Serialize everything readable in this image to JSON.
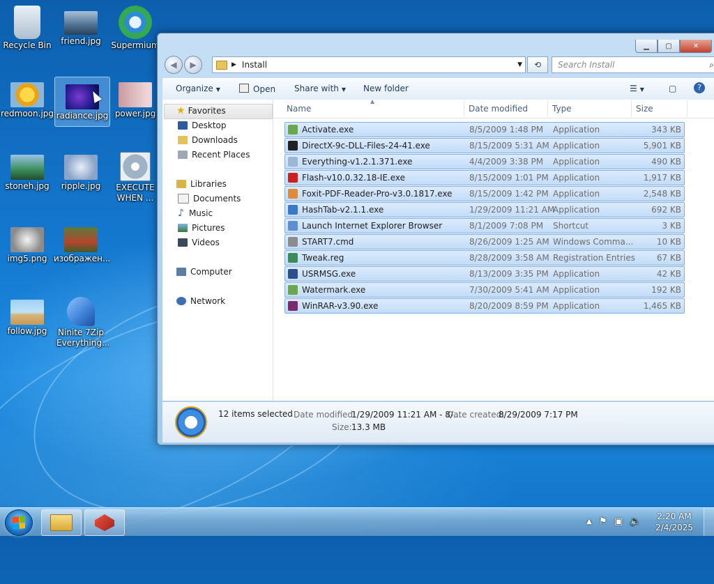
{
  "desktop": {
    "icons": [
      {
        "label": "Recycle Bin",
        "color": "#c9d7e3"
      },
      {
        "label": "friend.jpg",
        "color": "#6a8db1"
      },
      {
        "label": "Supermium",
        "color": "#2f9b4a"
      },
      {
        "label": "redmoon.jpg",
        "color": "#e8a317"
      },
      {
        "label": "radiance.jpg",
        "color": "#231a8c"
      },
      {
        "label": "power.jpg",
        "color": "#e6c0c6"
      },
      {
        "label": "stoneh.jpg",
        "color": "#3c8d5a"
      },
      {
        "label": "ripple.jpg",
        "color": "#8aa3c8"
      },
      {
        "label": "EXECUTE WHEN ...",
        "color": "#9fb3c5"
      },
      {
        "label": "img5.png",
        "color": "#8b8b8b"
      },
      {
        "label": "изображен...",
        "color": "#b4462e"
      },
      {
        "label": "follow.jpg",
        "color": "#d7b47a"
      },
      {
        "label": "Ninite 7Zip Everything...",
        "color": "#3b7fd6"
      }
    ]
  },
  "window": {
    "address_path": "Install",
    "search_placeholder": "Search Install",
    "commands": {
      "organize": "Organize",
      "open": "Open",
      "share_with": "Share with",
      "new_folder": "New folder"
    },
    "nav": {
      "favorites": "Favorites",
      "desktop": "Desktop",
      "downloads": "Downloads",
      "recent_places": "Recent Places",
      "libraries": "Libraries",
      "documents": "Documents",
      "music": "Music",
      "pictures": "Pictures",
      "videos": "Videos",
      "computer": "Computer",
      "network": "Network"
    },
    "columns": {
      "name": "Name",
      "date_modified": "Date modified",
      "type": "Type",
      "size": "Size"
    },
    "files": [
      {
        "name": "Activate.exe",
        "date": "8/5/2009 1:48 PM",
        "type": "Application",
        "size": "343 KB",
        "icon_color": "#6aa84f"
      },
      {
        "name": "DirectX-9c-DLL-Files-24-41.exe",
        "date": "8/15/2009 5:31 AM",
        "type": "Application",
        "size": "5,901 KB",
        "icon_color": "#222222"
      },
      {
        "name": "Everything-v1.2.1.371.exe",
        "date": "4/4/2009 3:38 PM",
        "type": "Application",
        "size": "490 KB",
        "icon_color": "#9ab7d6"
      },
      {
        "name": "Flash-v10.0.32.18-IE.exe",
        "date": "8/15/2009 1:01 PM",
        "type": "Application",
        "size": "1,917 KB",
        "icon_color": "#cc1f1f"
      },
      {
        "name": "Foxit-PDF-Reader-Pro-v3.0.1817.exe",
        "date": "8/15/2009 1:42 PM",
        "type": "Application",
        "size": "2,548 KB",
        "icon_color": "#e08a3c"
      },
      {
        "name": "HashTab-v2.1.1.exe",
        "date": "1/29/2009 11:21 AM",
        "type": "Application",
        "size": "692 KB",
        "icon_color": "#3b79c8"
      },
      {
        "name": "Launch Internet Explorer Browser",
        "date": "8/1/2009 7:08 PM",
        "type": "Shortcut",
        "size": "3 KB",
        "icon_color": "#5d8ecf"
      },
      {
        "name": "START7.cmd",
        "date": "8/26/2009 1:25 AM",
        "type": "Windows Comma...",
        "size": "10 KB",
        "icon_color": "#8c8c8c"
      },
      {
        "name": "Tweak.reg",
        "date": "8/28/2009 3:58 AM",
        "type": "Registration Entries",
        "size": "67 KB",
        "icon_color": "#3b8c5a"
      },
      {
        "name": "USRMSG.exe",
        "date": "8/13/2009 3:35 PM",
        "type": "Application",
        "size": "42 KB",
        "icon_color": "#2a4f8c"
      },
      {
        "name": "Watermark.exe",
        "date": "7/30/2009 5:41 AM",
        "type": "Application",
        "size": "192 KB",
        "icon_color": "#6aa84f"
      },
      {
        "name": "WinRAR-v3.90.exe",
        "date": "8/20/2009 8:59 PM",
        "type": "Application",
        "size": "1,465 KB",
        "icon_color": "#7b2a6d"
      }
    ],
    "details": {
      "selected": "12 items selected",
      "date_modified_label": "Date modified:",
      "date_modified_value": "1/29/2009 11:21 AM - 8/...",
      "date_created_label": "Date created:",
      "date_created_value": "8/29/2009 7:17 PM",
      "size_label": "Size:",
      "size_value": "13.3 MB"
    }
  },
  "taskbar": {
    "time": "2:20 AM",
    "date": "2/4/2025"
  }
}
